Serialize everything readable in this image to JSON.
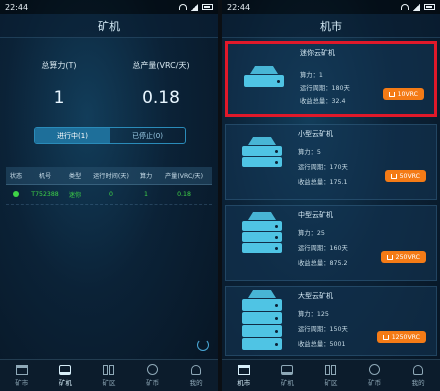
{
  "left": {
    "status_time": "22:44",
    "title": "矿机",
    "stats": {
      "total_power_label": "总算力(T)",
      "total_power_value": "1",
      "total_output_label": "总产量(VRC/天)",
      "total_output_value": "0.18"
    },
    "segments": {
      "running": "进行中(1)",
      "stopped": "已停止(0)"
    },
    "table": {
      "headers": [
        "状态",
        "机号",
        "类型",
        "运行时间(天)",
        "算力",
        "产量(VRC/天)"
      ],
      "rows": [
        {
          "machine_id": "T752388",
          "type": "迷你",
          "days": "0",
          "power": "1",
          "output": "0.18"
        }
      ]
    },
    "tabs": [
      "矿市",
      "矿机",
      "矿区",
      "矿币",
      "我的"
    ],
    "active_tab": "矿机"
  },
  "right": {
    "status_time": "22:44",
    "title": "机市",
    "cards": [
      {
        "name": "迷你云矿机",
        "power": "算力：1",
        "period": "运行周期：180天",
        "yield": "收益总量：32.4",
        "price": "10VRC"
      },
      {
        "name": "小型云矿机",
        "power": "算力：5",
        "period": "运行周期：170天",
        "yield": "收益总量：175.1",
        "price": "50VRC"
      },
      {
        "name": "中型云矿机",
        "power": "算力：25",
        "period": "运行周期：160天",
        "yield": "收益总量：875.2",
        "price": "250VRC"
      },
      {
        "name": "大型云矿机",
        "power": "算力：125",
        "period": "运行周期：150天",
        "yield": "收益总量：5001",
        "price": "1250VRC"
      }
    ],
    "tabs": [
      "机市",
      "矿机",
      "矿区",
      "矿币",
      "我的"
    ],
    "active_tab": "机市"
  },
  "colors": {
    "accent": "#f47b16",
    "highlight": "#e0192a",
    "status_green": "#3fd447",
    "icon": "#4fc4e4"
  }
}
